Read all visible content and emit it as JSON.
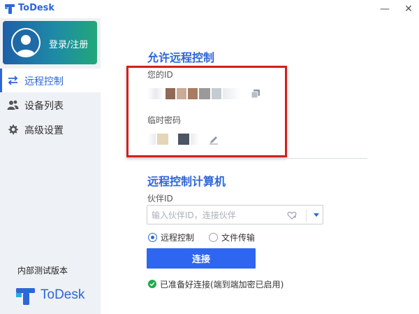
{
  "window": {
    "title": "ToDesk",
    "minimize_glyph": "—",
    "close_glyph": "✕"
  },
  "sidebar": {
    "login_label": "登录/注册",
    "items": [
      {
        "label": "远程控制",
        "icon": "swap-arrows-icon",
        "active": true
      },
      {
        "label": "设备列表",
        "icon": "users-icon",
        "active": false
      },
      {
        "label": "高级设置",
        "icon": "gear-icon",
        "active": false
      }
    ],
    "build_label": "内部测试版本",
    "brand_text": "ToDesk"
  },
  "allow_remote": {
    "title": "允许远程控制",
    "id_label": "您的ID",
    "password_label": "临时密码"
  },
  "control_remote": {
    "title": "远程控制计算机",
    "partner_label": "伙伴ID",
    "partner_placeholder": "输入伙伴ID，连接伙伴",
    "partner_value": "",
    "mode_options": [
      {
        "label": "远程控制",
        "selected": true
      },
      {
        "label": "文件传输",
        "selected": false
      }
    ],
    "connect_label": "连接",
    "status_text": "已准备好连接(端到端加密已启用)"
  },
  "colors": {
    "accent": "#2d66d9",
    "button": "#2f66f0",
    "highlight_box": "#d21f1f",
    "status_ok": "#1faa4a"
  }
}
